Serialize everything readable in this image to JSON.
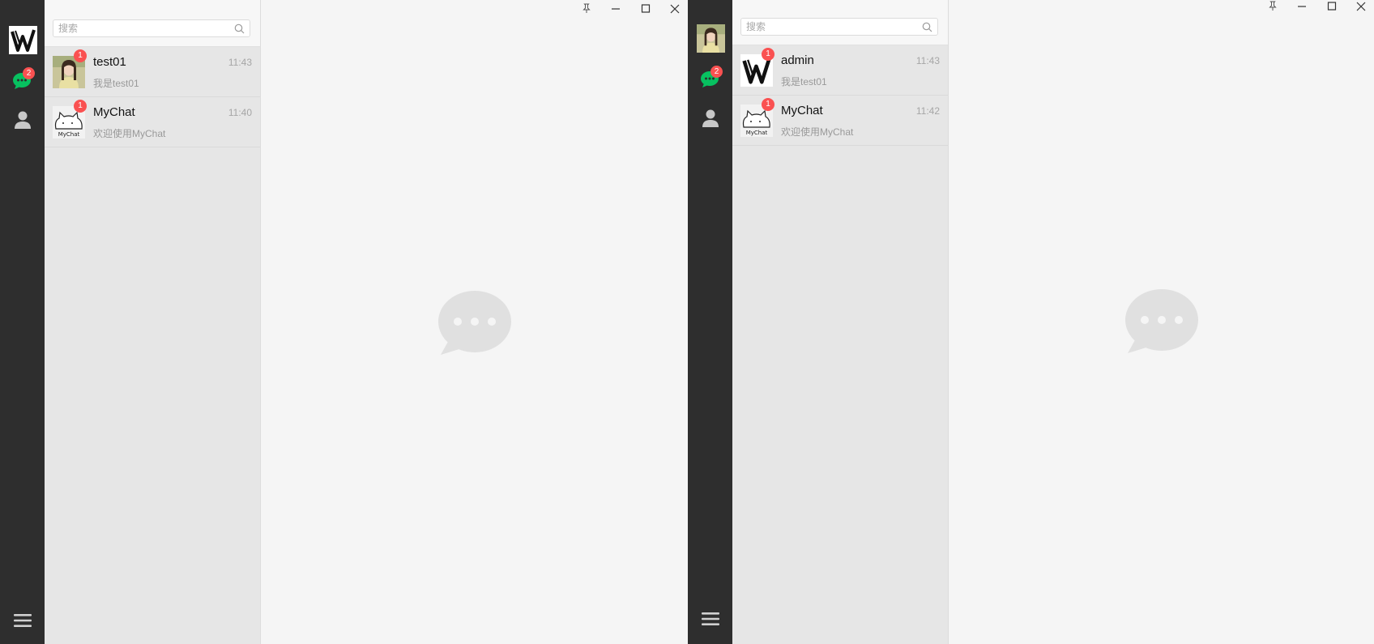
{
  "windows": [
    {
      "id": "left",
      "user_avatar": "w-logo-avatar",
      "chat_badge": "2",
      "search": {
        "placeholder": "搜索"
      },
      "conversations": [
        {
          "name": "test01",
          "time": "11:43",
          "message": "我是test01",
          "badge": "1",
          "avatar": "girl-photo-avatar"
        },
        {
          "name": "MyChat",
          "time": "11:40",
          "message": "欢迎使用MyChat",
          "badge": "1",
          "avatar": "mychat-cat-avatar"
        }
      ]
    },
    {
      "id": "right",
      "user_avatar": "girl-photo-avatar",
      "chat_badge": "2",
      "search": {
        "placeholder": "搜索"
      },
      "conversations": [
        {
          "name": "admin",
          "time": "11:43",
          "message": "我是test01",
          "badge": "1",
          "avatar": "w-logo-avatar"
        },
        {
          "name": "MyChat",
          "time": "11:42",
          "message": "欢迎使用MyChat",
          "badge": "1",
          "avatar": "mychat-cat-avatar"
        }
      ]
    }
  ],
  "avatar_labels": {
    "mychat": "MyChat"
  },
  "colors": {
    "rail": "#2e2e2e",
    "accent_green": "#07c160",
    "badge_red": "#fa5151",
    "list_bg": "#e6e6e6",
    "main_bg": "#f5f5f5"
  },
  "icons": [
    "pin-icon",
    "minimize-icon",
    "maximize-icon",
    "close-icon",
    "search-icon",
    "chat-icon",
    "contacts-icon",
    "menu-icon",
    "empty-chat-icon"
  ]
}
